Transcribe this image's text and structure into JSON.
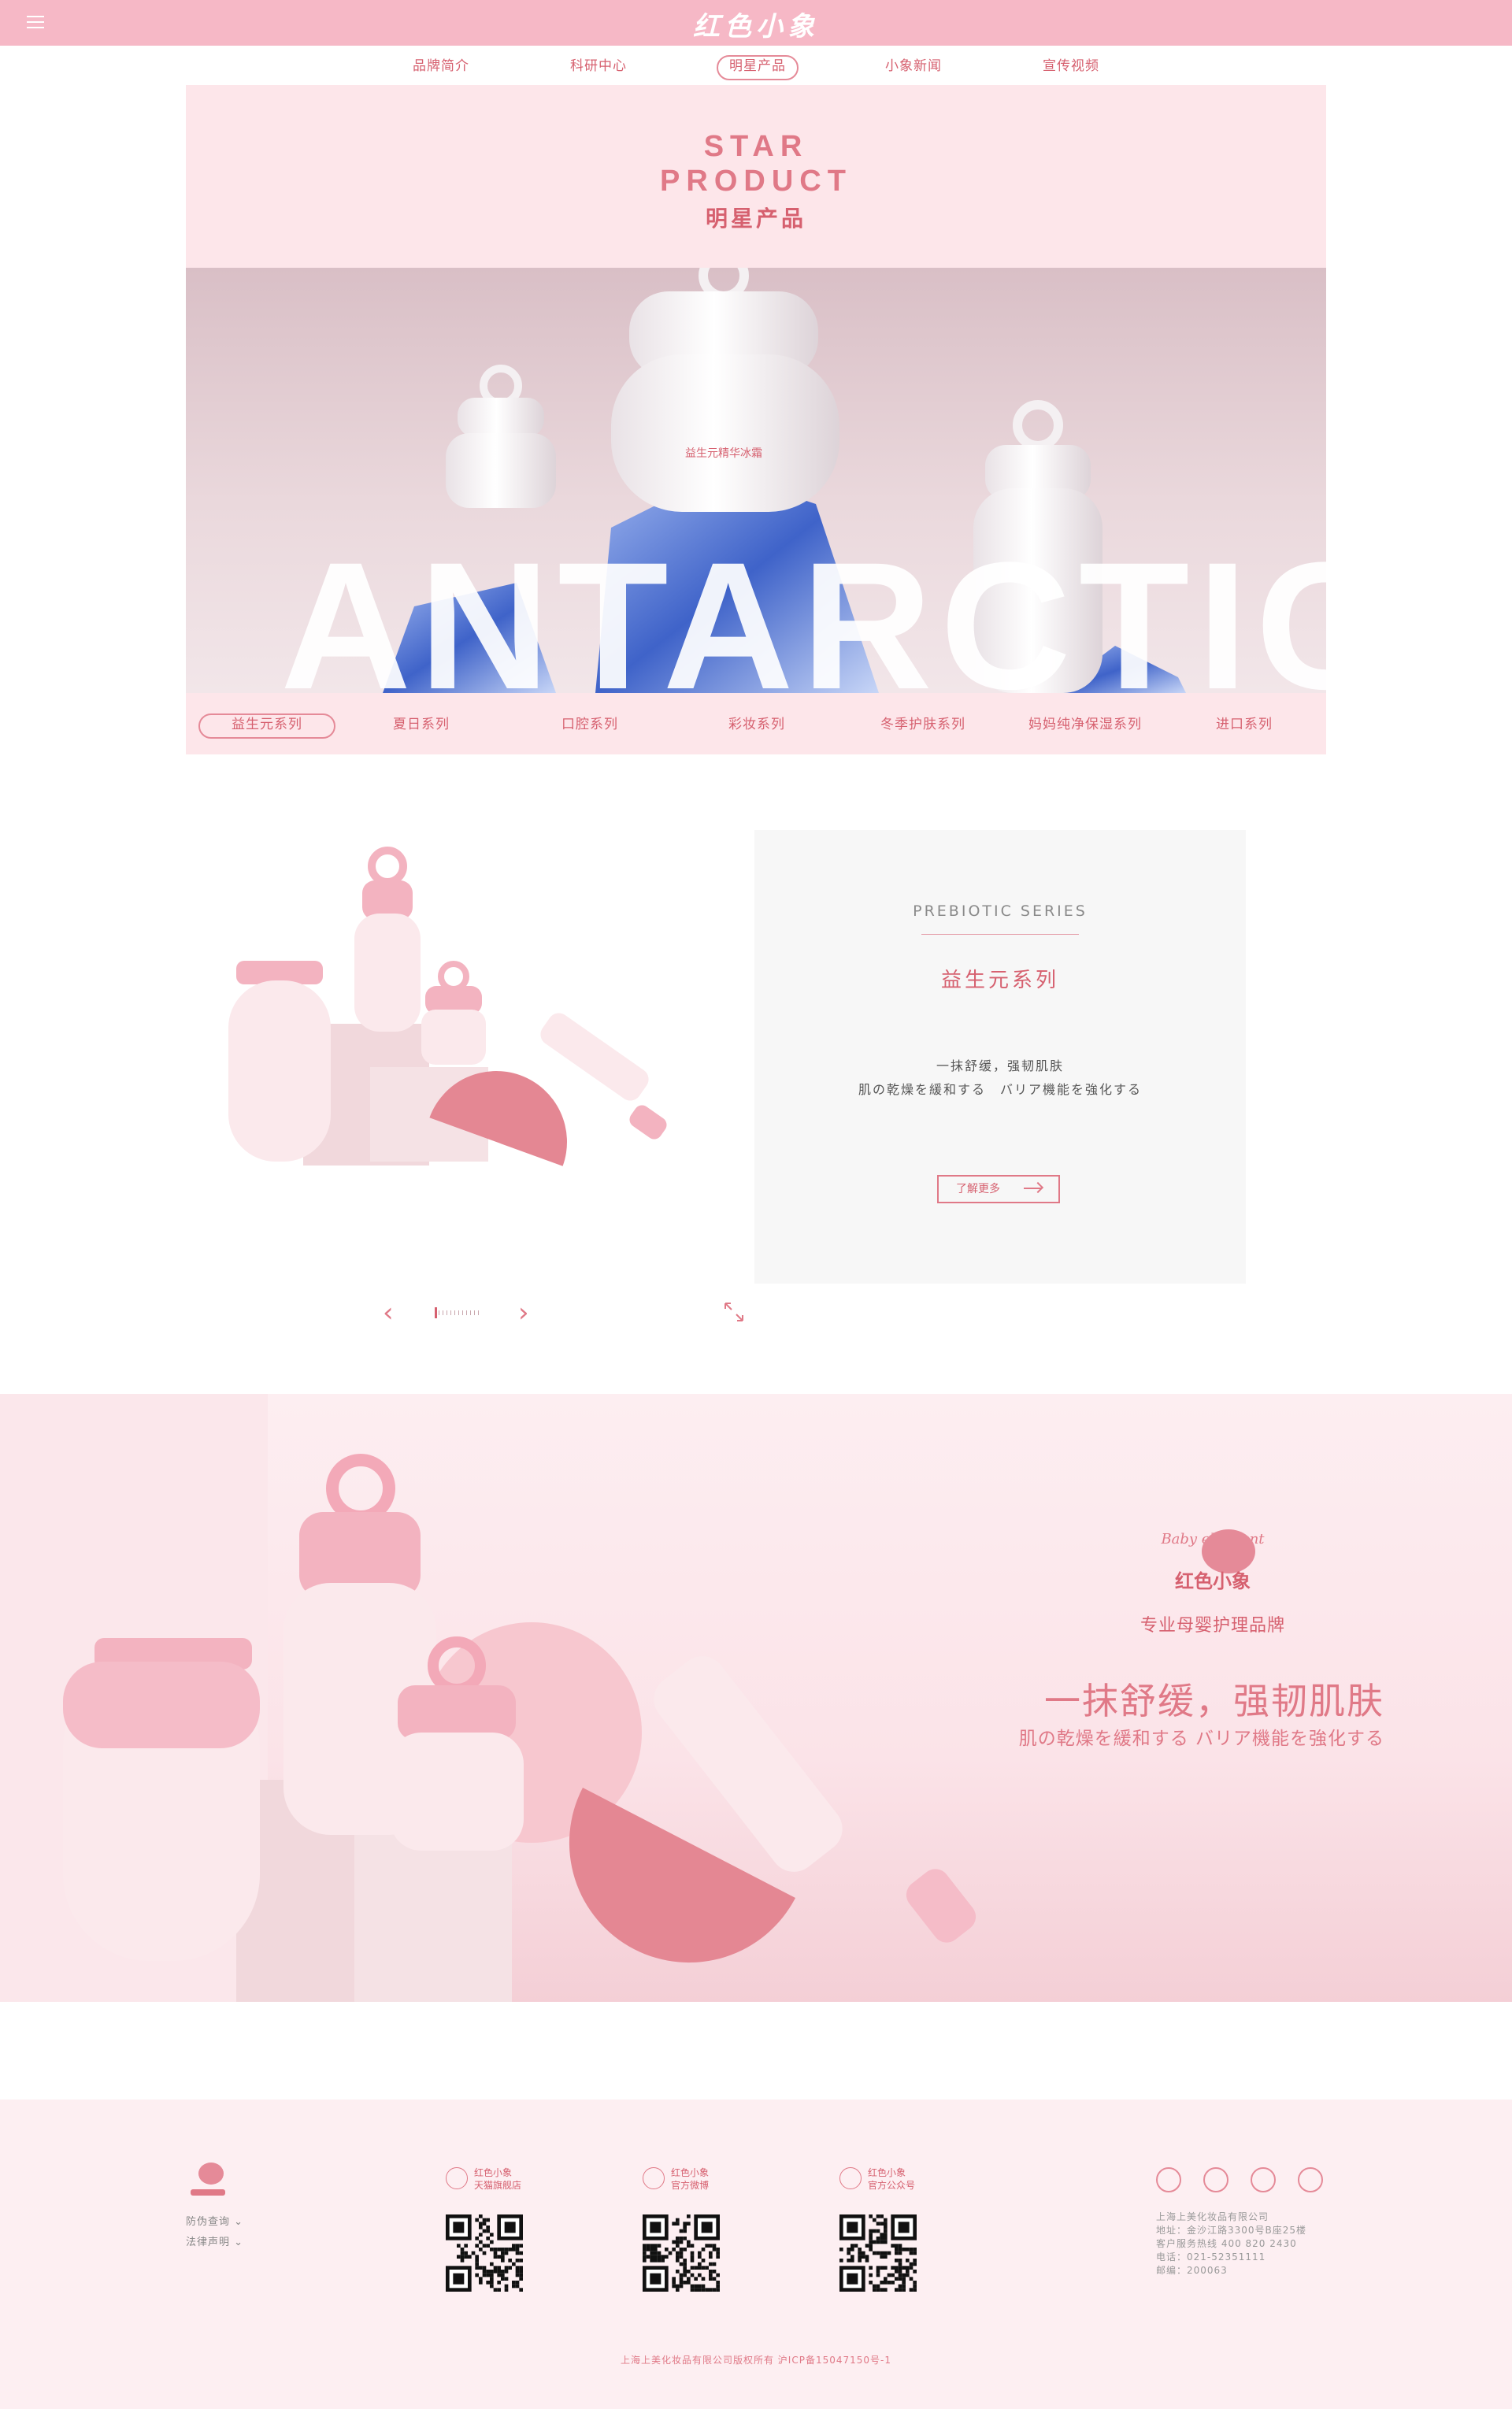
{
  "header": {
    "logo": "红色小象"
  },
  "nav": [
    {
      "label": "品牌简介",
      "active": false
    },
    {
      "label": "科研中心",
      "active": false
    },
    {
      "label": "明星产品",
      "active": true
    },
    {
      "label": "小象新闻",
      "active": false
    },
    {
      "label": "宣传视频",
      "active": false
    }
  ],
  "star": {
    "title_en_1": "STAR",
    "title_en_2": "PRODUCT",
    "title_cn": "明星产品",
    "hero_word": "ANTARCTIC",
    "series_tabs": [
      {
        "label": "益生元系列",
        "active": true
      },
      {
        "label": "夏日系列",
        "active": false
      },
      {
        "label": "口腔系列",
        "active": false
      },
      {
        "label": "彩妆系列",
        "active": false
      },
      {
        "label": "冬季护肤系列",
        "active": false
      },
      {
        "label": "妈妈纯净保湿系列",
        "active": false
      },
      {
        "label": "进口系列",
        "active": false
      }
    ]
  },
  "series_card": {
    "title_en": "PREBIOTIC SERIES",
    "title_cn": "益生元系列",
    "desc_cn": "一抹舒缓，强韧肌肤",
    "desc_jp": "肌の乾燥を緩和する　バリア機能を強化する",
    "more_label": "了解更多"
  },
  "slider": {
    "prev": "‹",
    "next": "›",
    "progress": 0.05
  },
  "banner": {
    "brand_logo_en": "Baby elephant",
    "brand_logo_cn": "红色小象",
    "brand_tag": "专业母婴护理品牌",
    "slogan_cn": "一抹舒缓，强韧肌肤",
    "slogan_jp": "肌の乾燥を緩和する  バリア機能を強化する"
  },
  "footer": {
    "links": [
      "防伪查询",
      "法律声明"
    ],
    "qr": [
      {
        "line1": "红色小象",
        "line2": "天猫旗舰店",
        "icon": "tmall-icon"
      },
      {
        "line1": "红色小象",
        "line2": "官方微博",
        "icon": "weibo-icon"
      },
      {
        "line1": "红色小象",
        "line2": "官方公众号",
        "icon": "wechat-icon"
      }
    ],
    "contact": [
      "上海上美化妆品有限公司",
      "地址：金沙江路3300号B座25楼",
      "客户服务热线 400 820 2430",
      "电话：021-52351111",
      "邮编：200063"
    ],
    "copyright": "上海上美化妆品有限公司版权所有 沪ICP备15047150号-1"
  },
  "colors": {
    "brand_pink": "#f6b8c6",
    "accent": "#d6606f",
    "panel": "#fde6ea"
  }
}
